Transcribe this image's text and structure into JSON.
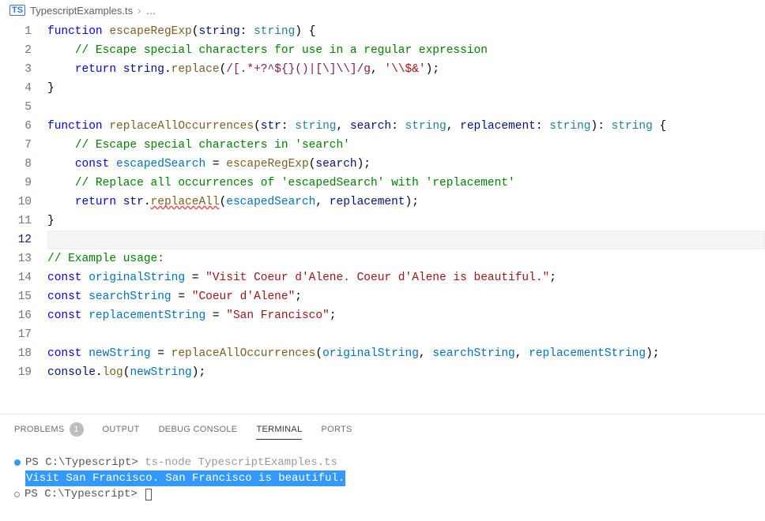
{
  "breadcrumb": {
    "icon_label": "TS",
    "filename": "TypescriptExamples.ts",
    "chevron": "›",
    "trailing": "…"
  },
  "editor": {
    "lines": [
      {
        "n": 1,
        "tokens": [
          [
            "keyword",
            "function "
          ],
          [
            "func",
            "escapeRegExp"
          ],
          [
            "punc",
            "("
          ],
          [
            "param",
            "string"
          ],
          [
            "punc",
            ": "
          ],
          [
            "type",
            "string"
          ],
          [
            "punc",
            ") {"
          ]
        ]
      },
      {
        "n": 2,
        "tokens": [
          [
            "default",
            "    "
          ],
          [
            "comment",
            "// Escape special characters for use in a regular expression"
          ]
        ]
      },
      {
        "n": 3,
        "tokens": [
          [
            "default",
            "    "
          ],
          [
            "keyword",
            "return "
          ],
          [
            "param",
            "string"
          ],
          [
            "punc",
            "."
          ],
          [
            "func",
            "replace"
          ],
          [
            "punc",
            "("
          ],
          [
            "regex",
            "/[.*+?^${}()|[\\]\\\\]/g"
          ],
          [
            "punc",
            ", "
          ],
          [
            "string",
            "'\\\\$&'"
          ],
          [
            "punc",
            ");"
          ]
        ]
      },
      {
        "n": 4,
        "tokens": [
          [
            "punc",
            "}"
          ]
        ]
      },
      {
        "n": 5,
        "tokens": [
          [
            "default",
            ""
          ]
        ]
      },
      {
        "n": 6,
        "tokens": [
          [
            "keyword",
            "function "
          ],
          [
            "func",
            "replaceAllOccurrences"
          ],
          [
            "punc",
            "("
          ],
          [
            "param",
            "str"
          ],
          [
            "punc",
            ": "
          ],
          [
            "type",
            "string"
          ],
          [
            "punc",
            ", "
          ],
          [
            "param",
            "search"
          ],
          [
            "punc",
            ": "
          ],
          [
            "type",
            "string"
          ],
          [
            "punc",
            ", "
          ],
          [
            "param",
            "replacement"
          ],
          [
            "punc",
            ": "
          ],
          [
            "type",
            "string"
          ],
          [
            "punc",
            "): "
          ],
          [
            "type",
            "string"
          ],
          [
            "punc",
            " {"
          ]
        ]
      },
      {
        "n": 7,
        "tokens": [
          [
            "default",
            "    "
          ],
          [
            "comment",
            "// Escape special characters in 'search'"
          ]
        ]
      },
      {
        "n": 8,
        "tokens": [
          [
            "default",
            "    "
          ],
          [
            "keyword",
            "const "
          ],
          [
            "var",
            "escapedSearch"
          ],
          [
            "punc",
            " = "
          ],
          [
            "func",
            "escapeRegExp"
          ],
          [
            "punc",
            "("
          ],
          [
            "param",
            "search"
          ],
          [
            "punc",
            ");"
          ]
        ]
      },
      {
        "n": 9,
        "tokens": [
          [
            "default",
            "    "
          ],
          [
            "comment",
            "// Replace all occurrences of 'escapedSearch' with 'replacement'"
          ]
        ]
      },
      {
        "n": 10,
        "tokens": [
          [
            "default",
            "    "
          ],
          [
            "keyword",
            "return "
          ],
          [
            "param",
            "str"
          ],
          [
            "punc",
            "."
          ],
          [
            "func-squiggle",
            "replaceAll"
          ],
          [
            "punc",
            "("
          ],
          [
            "var",
            "escapedSearch"
          ],
          [
            "punc",
            ", "
          ],
          [
            "param",
            "replacement"
          ],
          [
            "punc",
            ");"
          ]
        ]
      },
      {
        "n": 11,
        "tokens": [
          [
            "punc",
            "}"
          ]
        ]
      },
      {
        "n": 12,
        "tokens": [
          [
            "default",
            ""
          ]
        ],
        "current": true
      },
      {
        "n": 13,
        "tokens": [
          [
            "comment",
            "// Example usage:"
          ]
        ]
      },
      {
        "n": 14,
        "tokens": [
          [
            "keyword",
            "const "
          ],
          [
            "var",
            "originalString"
          ],
          [
            "punc",
            " = "
          ],
          [
            "string",
            "\"Visit Coeur d'Alene. Coeur d'Alene is beautiful.\""
          ],
          [
            "punc",
            ";"
          ]
        ]
      },
      {
        "n": 15,
        "tokens": [
          [
            "keyword",
            "const "
          ],
          [
            "var",
            "searchString"
          ],
          [
            "punc",
            " = "
          ],
          [
            "string",
            "\"Coeur d'Alene\""
          ],
          [
            "punc",
            ";"
          ]
        ]
      },
      {
        "n": 16,
        "tokens": [
          [
            "keyword",
            "const "
          ],
          [
            "var",
            "replacementString"
          ],
          [
            "punc",
            " = "
          ],
          [
            "string",
            "\"San Francisco\""
          ],
          [
            "punc",
            ";"
          ]
        ]
      },
      {
        "n": 17,
        "tokens": [
          [
            "default",
            ""
          ]
        ]
      },
      {
        "n": 18,
        "tokens": [
          [
            "keyword",
            "const "
          ],
          [
            "var",
            "newString"
          ],
          [
            "punc",
            " = "
          ],
          [
            "func",
            "replaceAllOccurrences"
          ],
          [
            "punc",
            "("
          ],
          [
            "var",
            "originalString"
          ],
          [
            "punc",
            ", "
          ],
          [
            "var",
            "searchString"
          ],
          [
            "punc",
            ", "
          ],
          [
            "var",
            "replacementString"
          ],
          [
            "punc",
            ");"
          ]
        ]
      },
      {
        "n": 19,
        "tokens": [
          [
            "param",
            "console"
          ],
          [
            "punc",
            "."
          ],
          [
            "func",
            "log"
          ],
          [
            "punc",
            "("
          ],
          [
            "var",
            "newString"
          ],
          [
            "punc",
            ");"
          ]
        ]
      }
    ]
  },
  "panel": {
    "tabs": {
      "problems": {
        "label": "PROBLEMS",
        "badge": "1"
      },
      "output": {
        "label": "OUTPUT"
      },
      "debug": {
        "label": "DEBUG CONSOLE"
      },
      "terminal": {
        "label": "TERMINAL"
      },
      "ports": {
        "label": "PORTS"
      }
    }
  },
  "terminal": {
    "line1_prompt": "PS C:\\Typescript> ",
    "line1_cmd": "ts-node TypescriptExamples.ts",
    "output_text": "Visit San Francisco. San Francisco is beautiful.",
    "line3_prompt": "PS C:\\Typescript> "
  }
}
